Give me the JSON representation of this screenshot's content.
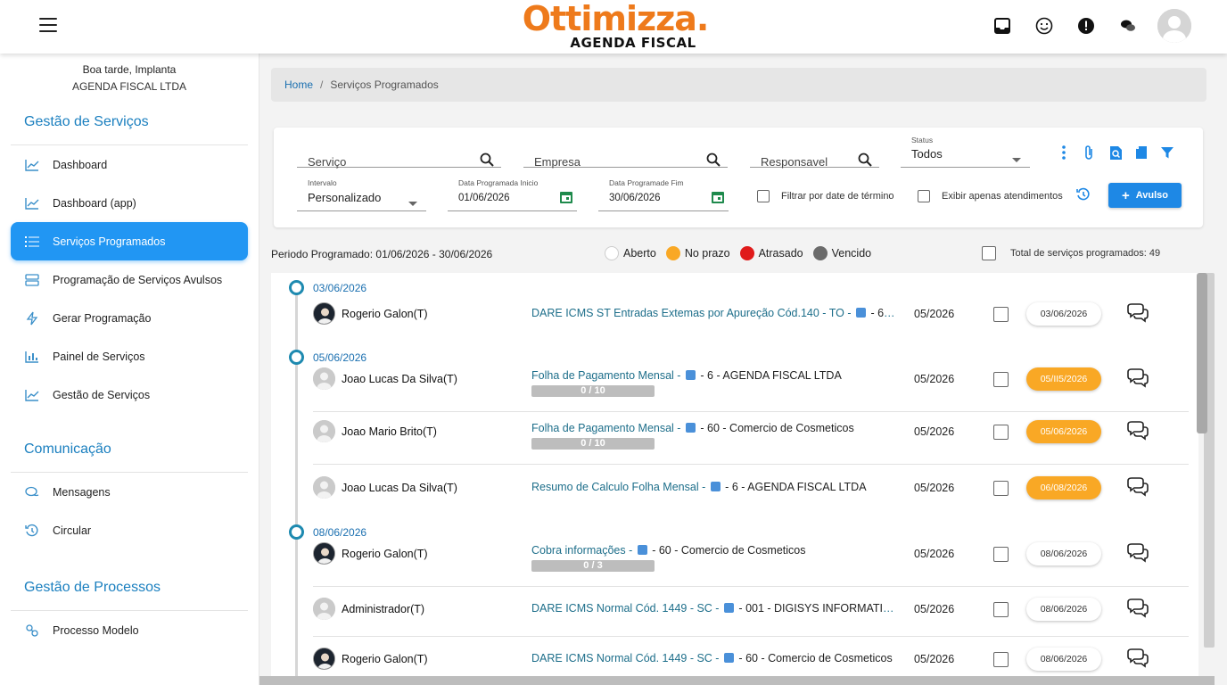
{
  "app": {
    "logo_main": "Ottimizza.",
    "logo_sub": "AGENDA FISCAL"
  },
  "user": {
    "greeting": "Boa tarde, Implanta",
    "company": "AGENDA FISCAL LTDA"
  },
  "sidebar": {
    "sections": [
      {
        "title": "Gestão de Serviços"
      },
      {
        "title": "Comunicação"
      },
      {
        "title": "Gestão de Processos"
      }
    ],
    "items": [
      {
        "label": "Dashboard",
        "icon": "chart-line-icon"
      },
      {
        "label": "Dashboard (app)",
        "icon": "chart-line-icon"
      },
      {
        "label": "Serviços Programados",
        "icon": "list-icon",
        "active": true
      },
      {
        "label": "Programação de Serviços Avulsos",
        "icon": "table-icon"
      },
      {
        "label": "Gerar Programação",
        "icon": "bolt-icon"
      },
      {
        "label": "Painel de Serviços",
        "icon": "bar-chart-icon"
      },
      {
        "label": "Gestão de Serviços",
        "icon": "chart-line-icon"
      },
      {
        "label": "Mensagens",
        "icon": "chat-icon"
      },
      {
        "label": "Circular",
        "icon": "history-icon"
      },
      {
        "label": "Processo Modelo",
        "icon": "process-icon"
      }
    ]
  },
  "breadcrumb": {
    "home": "Home",
    "separator": "/",
    "current": "Serviços Programados"
  },
  "filters": {
    "servico_placeholder": "Serviço",
    "empresa_placeholder": "Empresa",
    "responsavel_placeholder": "Responsavel",
    "status_label": "Status",
    "status_value": "Todos",
    "intervalo_label": "Intervalo",
    "intervalo_value": "Personalizado",
    "data_inicio_label": "Data Programada Inicio",
    "data_inicio_value": "01/06/2026",
    "data_fim_label": "Data Programade Fim",
    "data_fim_value": "30/06/2026",
    "filtrar_termino_label": "Filtrar por date de término",
    "exibir_atendimentos_label": "Exibir apenas atendimentos",
    "avulso_label": "Avulso",
    "avulso_plus": "+"
  },
  "summary": {
    "periodo": "Periodo Programado: 01/06/2026 - 30/06/2026",
    "total": "Total de serviços programados: 49"
  },
  "legend": [
    {
      "label": "Aberto",
      "color": "#ffffff"
    },
    {
      "label": "No prazo",
      "color": "#f9a825"
    },
    {
      "label": "Atrasado",
      "color": "#e01b1b"
    },
    {
      "label": "Vencido",
      "color": "#6b6b6b"
    }
  ],
  "groups": [
    {
      "date": "03/06/2026",
      "rows": [
        {
          "name": "Rogerio Galon(T)",
          "avatar": "photo",
          "task": "DARE ICMS ST Entradas Extemas por Apureção Cód.140 - TO - ",
          "task_tail": "60 - ...",
          "competencia": "05/2026",
          "due": "03/06/2026",
          "badge": "white",
          "progress": ""
        }
      ]
    },
    {
      "date": "05/06/2026",
      "rows": [
        {
          "name": "Joao Lucas Da Silva(T)",
          "avatar": "gray",
          "task": "Folha de Pagamento Mensal - ",
          "task_tail": "6 - AGENDA FISCAL LTDA",
          "competencia": "05/2026",
          "due": "05/II5/2026",
          "badge": "orange",
          "progress": "0 / 10"
        },
        {
          "name": "Joao Mario Brito(T)",
          "avatar": "gray",
          "task": "Folha de Pagamento Mensal - ",
          "task_tail": "60 - Comercio de Cosmeticos",
          "competencia": "05/2026",
          "due": "05/06/2026",
          "badge": "orange",
          "progress": "0 / 10"
        },
        {
          "name": "Joao Lucas Da Silva(T)",
          "avatar": "gray",
          "task": "Resumo de Calculo Folha Mensal - ",
          "task_tail": "6 - AGENDA FISCAL LTDA",
          "competencia": "05/2026",
          "due": "06/08/2026",
          "badge": "orange",
          "progress": ""
        }
      ]
    },
    {
      "date": "08/06/2026",
      "rows": [
        {
          "name": "Rogerio Galon(T)",
          "avatar": "photo",
          "task": "Cobra informações - ",
          "task_tail": "60 - Comercio de Cosmeticos",
          "competencia": "05/2026",
          "due": "08/06/2026",
          "badge": "white",
          "progress": "0 / 3"
        },
        {
          "name": "Administrador(T)",
          "avatar": "gray",
          "task": "DARE ICMS Normal Cód. 1449 - SC - ",
          "task_tail": "001 - DIGISYS INFORMATICA L...",
          "competencia": "05/2026",
          "due": "08/06/2026",
          "badge": "white",
          "progress": ""
        },
        {
          "name": "Rogerio Galon(T)",
          "avatar": "photo",
          "task": "DARE ICMS Normal Cód. 1449 - SC - ",
          "task_tail": "60 - Comercio de Cosmeticos",
          "competencia": "05/2026",
          "due": "08/06/2026",
          "badge": "white",
          "progress": ""
        }
      ]
    }
  ]
}
